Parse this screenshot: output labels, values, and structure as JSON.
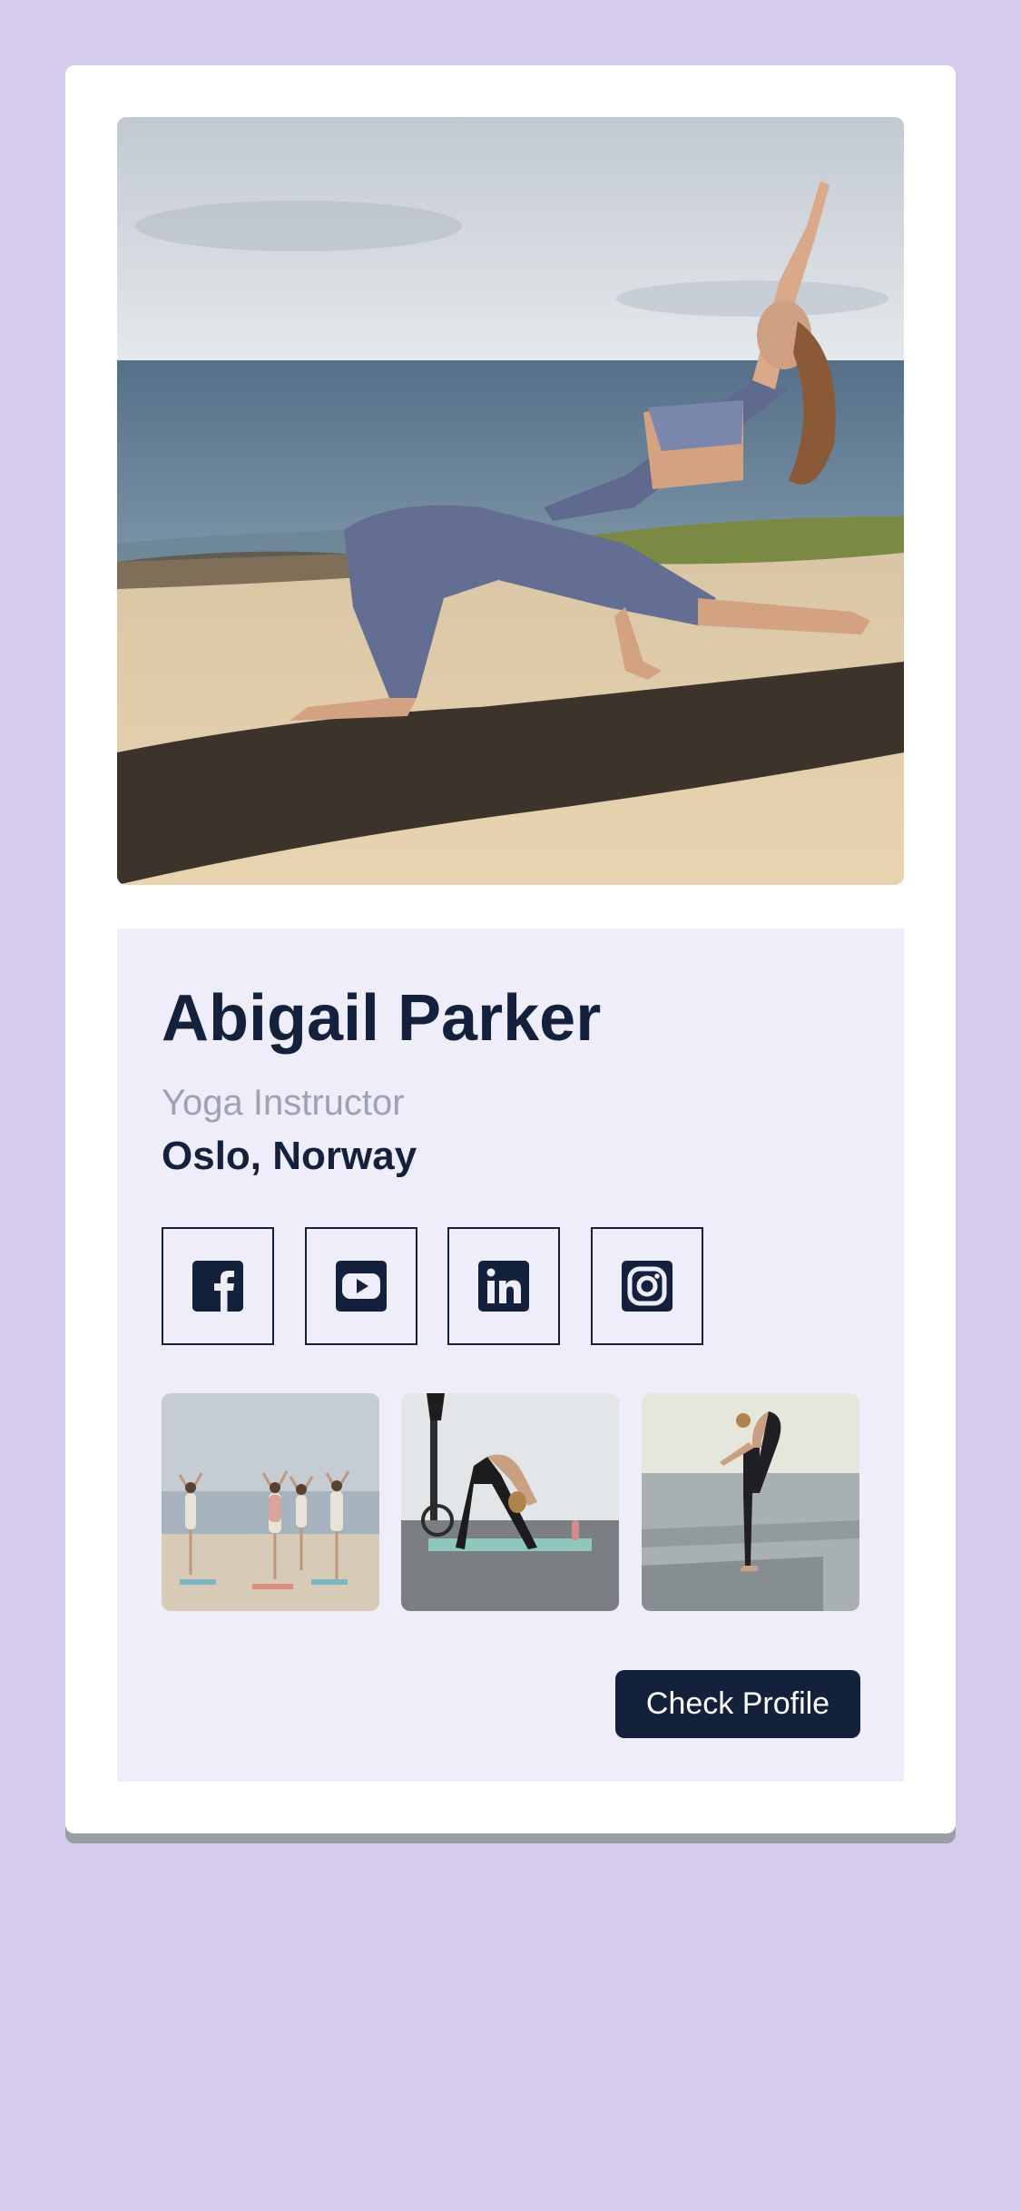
{
  "profile": {
    "name": "Abigail Parker",
    "role": "Yoga Instructor",
    "location": "Oslo, Norway"
  },
  "social_links": [
    {
      "network": "Facebook",
      "icon": "facebook-icon"
    },
    {
      "network": "YouTube",
      "icon": "youtube-icon"
    },
    {
      "network": "LinkedIn",
      "icon": "linkedin-icon"
    },
    {
      "network": "Instagram",
      "icon": "instagram-icon"
    }
  ],
  "gallery": [
    {
      "subject": "group yoga class on beach"
    },
    {
      "subject": "downward dog on mat"
    },
    {
      "subject": "standing bow pose"
    }
  ],
  "cta": {
    "label": "Check Profile"
  },
  "colors": {
    "page_background": "#d4cbed",
    "card_background": "#ffffff",
    "panel_background": "#efedfa",
    "primary_text": "#14213d",
    "secondary_text": "#9ca3af",
    "button_background": "#14213d",
    "button_text": "#ffffff"
  }
}
